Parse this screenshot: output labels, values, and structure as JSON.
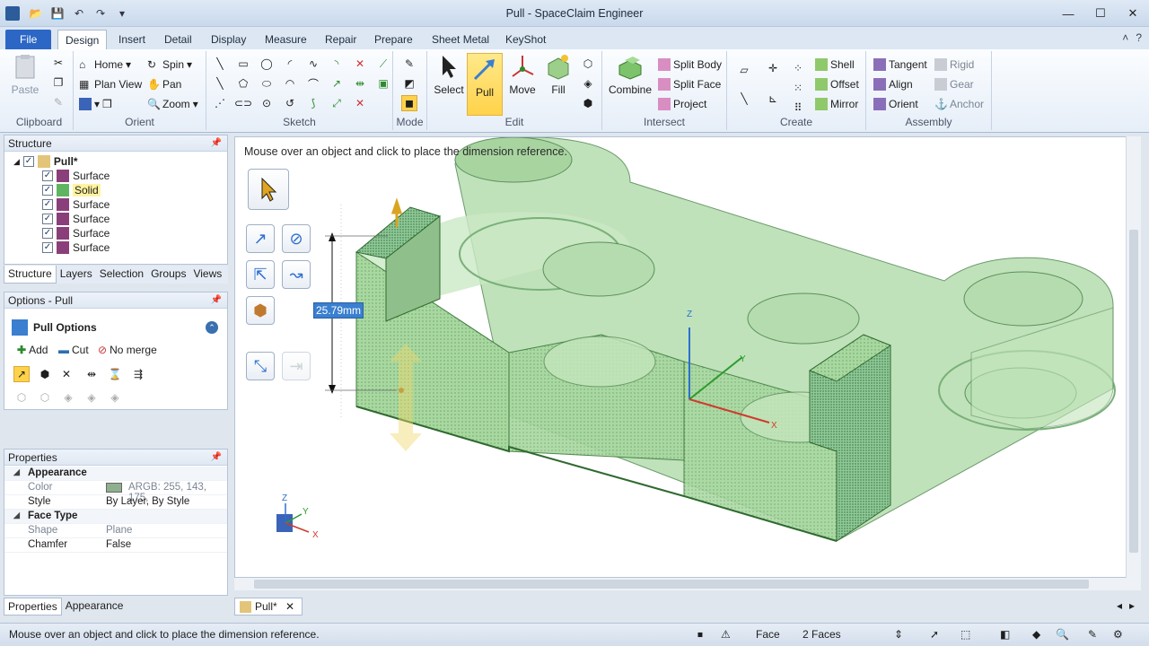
{
  "window": {
    "title": "Pull - SpaceClaim Engineer"
  },
  "tabs": [
    "File",
    "Design",
    "Insert",
    "Detail",
    "Display",
    "Measure",
    "Repair",
    "Prepare",
    "Sheet Metal",
    "KeyShot"
  ],
  "ribbon": {
    "clipboard": {
      "label": "Clipboard",
      "paste": "Paste"
    },
    "orient": {
      "label": "Orient",
      "home": "Home",
      "spin": "Spin",
      "plan_view": "Plan View",
      "pan": "Pan",
      "zoom": "Zoom"
    },
    "sketch": {
      "label": "Sketch"
    },
    "mode": {
      "label": "Mode"
    },
    "edit": {
      "label": "Edit",
      "select": "Select",
      "pull": "Pull",
      "move": "Move",
      "fill": "Fill"
    },
    "intersect": {
      "label": "Intersect",
      "combine": "Combine",
      "split_body": "Split Body",
      "split_face": "Split Face",
      "project": "Project"
    },
    "create": {
      "label": "Create",
      "shell": "Shell",
      "offset": "Offset",
      "mirror": "Mirror"
    },
    "assembly": {
      "label": "Assembly",
      "tangent": "Tangent",
      "align": "Align",
      "orient": "Orient",
      "rigid": "Rigid",
      "gear": "Gear",
      "anchor": "Anchor"
    }
  },
  "structure": {
    "title": "Structure",
    "root": "Pull*",
    "items": [
      "Surface",
      "Solid",
      "Surface",
      "Surface",
      "Surface",
      "Surface"
    ],
    "tabs": [
      "Structure",
      "Layers",
      "Selection",
      "Groups",
      "Views"
    ]
  },
  "options": {
    "title": "Options - Pull",
    "heading": "Pull Options",
    "add": "Add",
    "cut": "Cut",
    "no_merge": "No merge"
  },
  "properties": {
    "title": "Properties",
    "appearance_cat": "Appearance",
    "color_key": "Color",
    "color_val": "ARGB: 255, 143, 175,",
    "style_key": "Style",
    "style_val": "By Layer, By Style",
    "face_cat": "Face Type",
    "shape_key": "Shape",
    "shape_val": "Plane",
    "chamfer_key": "Chamfer",
    "chamfer_val": "False",
    "bottom_tabs": [
      "Properties",
      "Appearance"
    ]
  },
  "viewport": {
    "hint": "Mouse over an object and click to place the dimension reference.",
    "dimension": "25.79mm",
    "axis_z": "Z",
    "axis_y": "Y",
    "axis_x": "X"
  },
  "doc_tab": "Pull*",
  "status": {
    "message": "Mouse over an object and click to place the dimension reference.",
    "filter": "Face",
    "selection": "2 Faces"
  },
  "colors": {
    "accent": "#2c67c6",
    "part_fill": "#8fc99a",
    "highlight": "#ffd24a"
  }
}
